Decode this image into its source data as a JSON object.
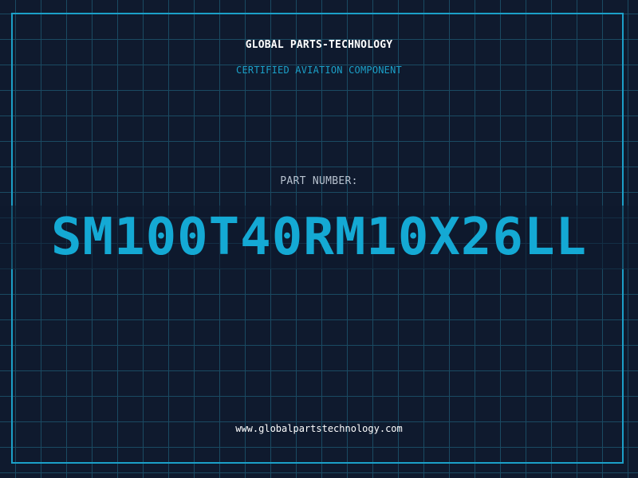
{
  "header": {
    "company": "GLOBAL PARTS-TECHNOLOGY",
    "subtitle": "CERTIFIED AVIATION COMPONENT"
  },
  "part": {
    "label": "PART NUMBER:",
    "number": "SM100T40RM10X26LL"
  },
  "footer": {
    "website": "www.globalpartstechnology.com"
  },
  "colors": {
    "background": "#0f1a2e",
    "grid": "#1a4a62",
    "accent": "#1ba0c8",
    "part_number": "#14a9d4",
    "text": "#ffffff"
  }
}
